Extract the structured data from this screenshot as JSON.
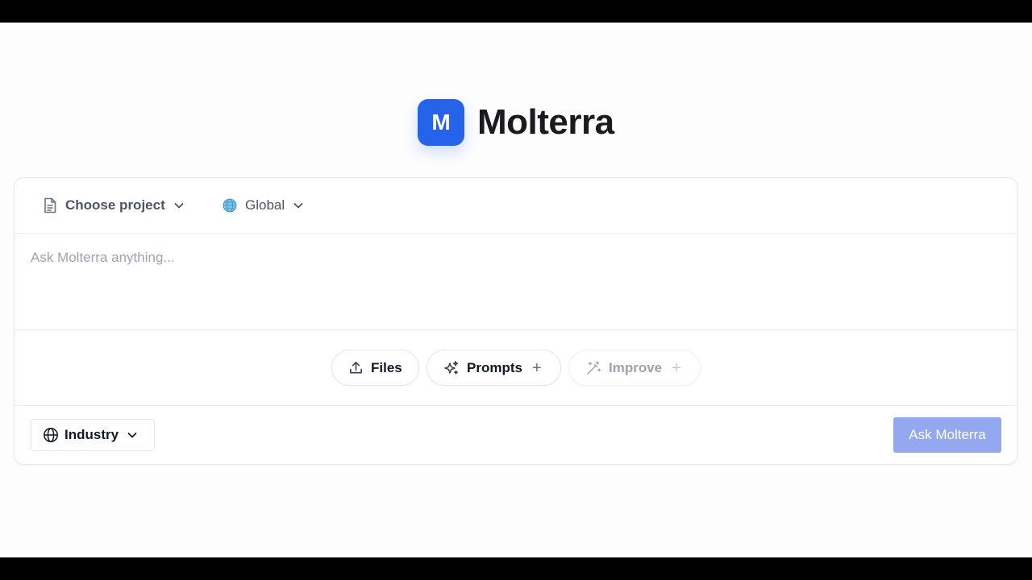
{
  "brand": {
    "logo_letter": "M",
    "name": "Molterra",
    "accent": "#2563eb"
  },
  "project_selector": {
    "label": "Choose project",
    "icon": "document-icon"
  },
  "scope_selector": {
    "label": "Global",
    "icon": "globe-emoji-icon"
  },
  "prompt": {
    "placeholder": "Ask Molterra anything...",
    "value": ""
  },
  "tools": {
    "files": {
      "label": "Files",
      "icon": "upload-icon"
    },
    "prompts": {
      "label": "Prompts",
      "icon": "sparkles-icon",
      "add": "+"
    },
    "improve": {
      "label": "Improve",
      "icon": "magic-wand-icon",
      "add": "+",
      "disabled": true
    }
  },
  "industry_selector": {
    "label": "Industry",
    "icon": "globe-icon"
  },
  "submit": {
    "label": "Ask Molterra",
    "color": "#93a8ef",
    "disabled": true
  }
}
